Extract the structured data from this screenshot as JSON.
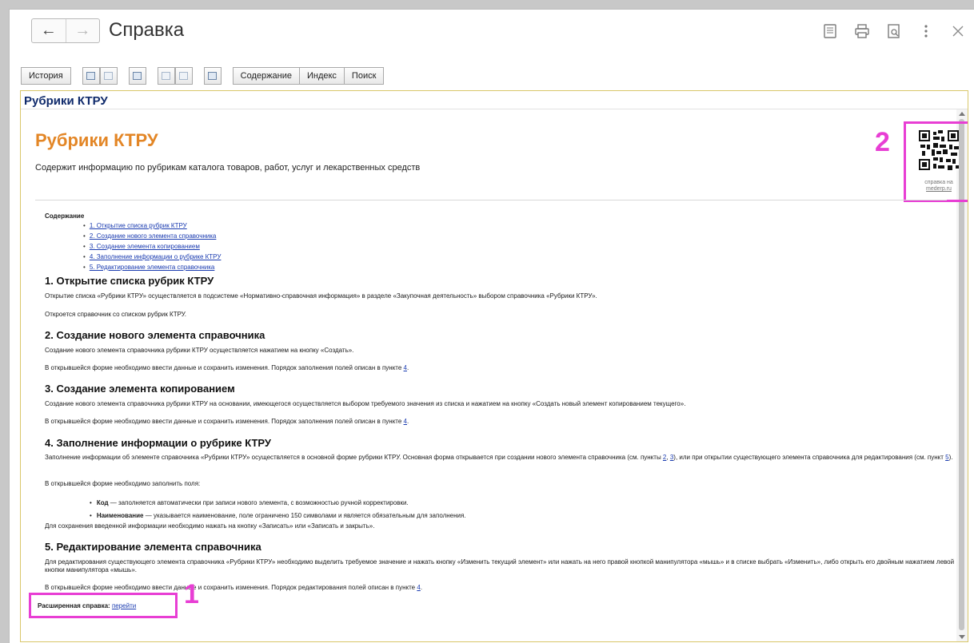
{
  "window": {
    "title": "Справка",
    "back_icon": "←",
    "forward_icon": "→",
    "tools": [
      "save-icon",
      "print-icon",
      "preview-icon",
      "more-icon",
      "close-icon"
    ]
  },
  "toolbar": {
    "history": "История",
    "contents": "Содержание",
    "index": "Индекс",
    "search": "Поиск"
  },
  "frame": {
    "header": "Рубрики КТРУ"
  },
  "doc": {
    "title": "Рубрики КТРУ",
    "subtitle": "Содержит информацию по рубрикам каталога товаров, работ, услуг и лекарственных средств",
    "qr_caption_1": "справка на",
    "qr_caption_2": "mederp.ru",
    "badge_qr": "2",
    "badge_ext": "1",
    "toc_title": "Содержание",
    "toc": [
      "1. Открытие списка рубрик КТРУ",
      "2. Создание нового элемента справочника",
      "3. Создание элемента копированием",
      "4. Заполнение информации о рубрике КТРУ",
      "5. Редактирование элемента справочника"
    ],
    "s1": {
      "title": "1. Открытие списка рубрик КТРУ",
      "p1": "Открытие списка «Рубрики КТРУ» осуществляется в подсистеме «Нормативно-справочная информация» в разделе «Закупочная деятельность» выбором справочника «Рубрики КТРУ».",
      "p2": "Откроется справочник со списком рубрик КТРУ."
    },
    "s2": {
      "title": "2. Создание нового элемента справочника",
      "p1": "Создание нового элемента справочника рубрики КТРУ осуществляется нажатием на кнопку «Создать».",
      "p2": "В открывшейся форме необходимо ввести данные и сохранить изменения. Порядок заполнения полей описан в пункте ",
      "p2_link": "4",
      "p2_end": "."
    },
    "s3": {
      "title": "3. Создание элемента копированием",
      "p1": "Создание нового элемента справочника рубрики КТРУ на основании, имеющегося осуществляется выбором требуемого значения из списка и нажатием на кнопку «Создать новый элемент копированием текущего».",
      "p2": "В открывшейся форме необходимо ввести данные и сохранить изменения. Порядок заполнения полей описан в пункте ",
      "p2_link": "4",
      "p2_end": "."
    },
    "s4": {
      "title": "4. Заполнение информации о рубрике КТРУ",
      "p1a": "Заполнение информации об элементе справочника «Рубрики КТРУ» осуществляется в основной форме рубрики КТРУ. Основная форма открывается при создании нового элемента справочника (см. пункты ",
      "p1_link2": "2",
      "p1_sep": ", ",
      "p1_link3": "3",
      "p1b": "), или при открытии существующего элемента справочника для редактирования (см. пункт ",
      "p1_link5": "5",
      "p1c": ").",
      "p2": "В открывшейся форме необходимо заполнить поля:",
      "b1_term": "Код",
      "b1_text": " — заполняется автоматически при записи нового элемента, с возможностью ручной корректировки.",
      "b2_term": "Наименование",
      "b2_text": "  — указывается наименование, поле ограничено 150 символами и является обязательным для заполнения.",
      "p3": "Для сохранения введенной информации необходимо нажать на кнопку «Записать» или «Записать и закрыть»."
    },
    "s5": {
      "title": "5. Редактирование элемента справочника",
      "p1": "Для редактирования существующего элемента справочника «Рубрики КТРУ» необходимо выделить требуемое значение и нажать кнопку «Изменить текущий элемент» или нажать на него правой кнопкой манипулятора «мышь» и в списке выбрать «Изменить», либо открыть его двойным нажатием левой кнопки манипулятора «мышь».",
      "p2": "В открывшейся форме необходимо ввести данные и сохранить изменения. Порядок редактирования полей описан в пункте ",
      "p2_link": "4",
      "p2_end": "."
    },
    "ext_label": "Расширенная справка: ",
    "ext_link": "перейти"
  }
}
